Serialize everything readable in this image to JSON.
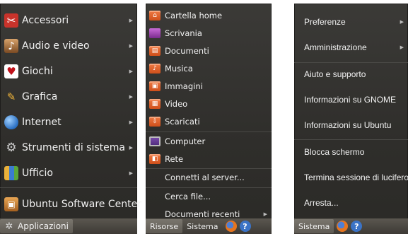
{
  "applications_menu": {
    "items": [
      {
        "label": "Accessori",
        "icon": "accessories-icon",
        "submenu": true
      },
      {
        "label": "Audio e video",
        "icon": "multimedia-icon",
        "submenu": true
      },
      {
        "label": "Giochi",
        "icon": "games-icon",
        "submenu": true
      },
      {
        "label": "Grafica",
        "icon": "graphics-icon",
        "submenu": true
      },
      {
        "label": "Internet",
        "icon": "internet-icon",
        "submenu": true
      },
      {
        "label": "Strumenti di sistema",
        "icon": "system-tools-icon",
        "submenu": true
      },
      {
        "label": "Ufficio",
        "icon": "office-icon",
        "submenu": true
      },
      {
        "label": "Ubuntu Software Center",
        "icon": "software-center-icon",
        "submenu": false
      }
    ],
    "taskbar_label": "Applicazioni"
  },
  "places_menu": {
    "items": [
      {
        "label": "Cartella home",
        "icon": "home-folder-icon"
      },
      {
        "label": "Scrivania",
        "icon": "desktop-icon"
      },
      {
        "label": "Documenti",
        "icon": "documents-folder-icon"
      },
      {
        "label": "Musica",
        "icon": "music-folder-icon"
      },
      {
        "label": "Immagini",
        "icon": "pictures-folder-icon"
      },
      {
        "label": "Video",
        "icon": "videos-folder-icon"
      },
      {
        "label": "Scaricati",
        "icon": "downloads-folder-icon"
      },
      {
        "label": "Computer",
        "icon": "computer-icon"
      },
      {
        "label": "Rete",
        "icon": "network-icon"
      },
      {
        "label": "Connetti al server...",
        "icon": null
      },
      {
        "label": "Cerca file...",
        "icon": null
      },
      {
        "label": "Documenti recenti",
        "icon": null,
        "submenu": true
      }
    ],
    "taskbar": {
      "active": "Risorse",
      "other": "Sistema"
    }
  },
  "system_menu": {
    "items": [
      {
        "label": "Preferenze",
        "submenu": true
      },
      {
        "label": "Amministrazione",
        "submenu": true
      },
      {
        "label": "Aiuto e supporto"
      },
      {
        "label": "Informazioni su GNOME"
      },
      {
        "label": "Informazioni su Ubuntu"
      },
      {
        "label": "Blocca schermo"
      },
      {
        "label": "Termina sessione di lucifero..."
      },
      {
        "label": "Arresta..."
      }
    ],
    "taskbar": {
      "active": "Sistema"
    }
  },
  "colors": {
    "panel_bg": "#2f2e2b",
    "folder_orange": "#e0602a",
    "text": "#f2f2f2"
  }
}
